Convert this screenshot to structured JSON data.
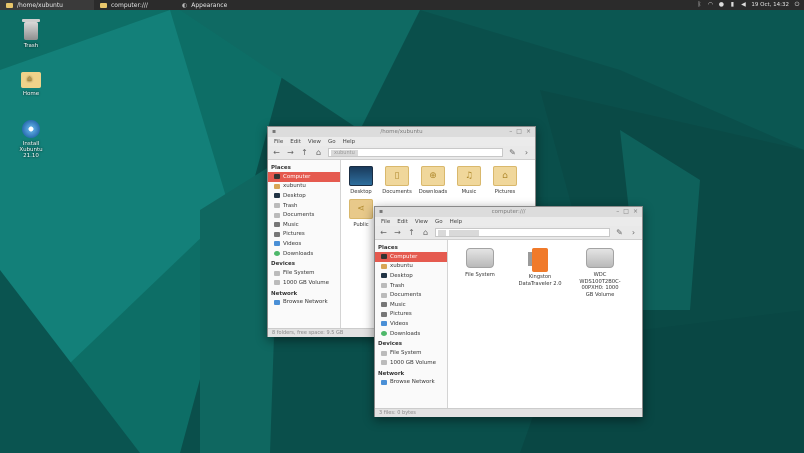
{
  "panel": {
    "tasks": [
      {
        "label": "/home/xubuntu",
        "icon": "folder-icon"
      },
      {
        "label": "computer:///",
        "icon": "folder-icon"
      },
      {
        "label": "Appearance",
        "icon": "appearance-icon"
      }
    ],
    "clock": "19 Oct, 14:32"
  },
  "desktop": {
    "icons": [
      {
        "label": "Trash",
        "icon": "trash-icon"
      },
      {
        "label": "Home",
        "icon": "home-folder-icon"
      },
      {
        "label": "Install Xubuntu 21.10",
        "icon": "install-disc-icon"
      }
    ]
  },
  "window_home": {
    "title": "/home/xubuntu",
    "menu": [
      "File",
      "Edit",
      "View",
      "Go",
      "Help"
    ],
    "crumb": "xubuntu",
    "sidebar": {
      "places_header": "Places",
      "places": [
        {
          "label": "Computer",
          "icon": "computer-icon",
          "selected": true
        },
        {
          "label": "xubuntu",
          "icon": "home-icon"
        },
        {
          "label": "Desktop",
          "icon": "desktop-icon"
        },
        {
          "label": "Trash",
          "icon": "trash-icon"
        },
        {
          "label": "Documents",
          "icon": "documents-icon"
        },
        {
          "label": "Music",
          "icon": "music-icon"
        },
        {
          "label": "Pictures",
          "icon": "pictures-icon"
        },
        {
          "label": "Videos",
          "icon": "videos-icon"
        },
        {
          "label": "Downloads",
          "icon": "downloads-icon"
        }
      ],
      "devices_header": "Devices",
      "devices": [
        {
          "label": "File System",
          "icon": "disk-icon"
        },
        {
          "label": "1000 GB Volume",
          "icon": "disk-icon"
        }
      ],
      "network_header": "Network",
      "network": [
        {
          "label": "Browse Network",
          "icon": "network-icon"
        }
      ]
    },
    "files": [
      {
        "label": "Desktop",
        "icon": "desktop-folder-icon"
      },
      {
        "label": "Documents",
        "icon": "documents-folder-icon"
      },
      {
        "label": "Downloads",
        "icon": "downloads-folder-icon"
      },
      {
        "label": "Music",
        "icon": "music-folder-icon"
      },
      {
        "label": "Pictures",
        "icon": "pictures-folder-icon"
      },
      {
        "label": "Public",
        "icon": "public-folder-icon"
      }
    ],
    "status": "8 folders, free space: 9.5 GB"
  },
  "window_computer": {
    "title": "computer:///",
    "menu": [
      "File",
      "Edit",
      "View",
      "Go",
      "Help"
    ],
    "sidebar": {
      "places_header": "Places",
      "places": [
        {
          "label": "Computer",
          "icon": "computer-icon",
          "selected": true
        },
        {
          "label": "xubuntu",
          "icon": "home-icon"
        },
        {
          "label": "Desktop",
          "icon": "desktop-icon"
        },
        {
          "label": "Trash",
          "icon": "trash-icon"
        },
        {
          "label": "Documents",
          "icon": "documents-icon"
        },
        {
          "label": "Music",
          "icon": "music-icon"
        },
        {
          "label": "Pictures",
          "icon": "pictures-icon"
        },
        {
          "label": "Videos",
          "icon": "videos-icon"
        },
        {
          "label": "Downloads",
          "icon": "downloads-icon"
        }
      ],
      "devices_header": "Devices",
      "devices": [
        {
          "label": "File System",
          "icon": "disk-icon"
        },
        {
          "label": "1000 GB Volume",
          "icon": "disk-icon"
        }
      ],
      "network_header": "Network",
      "network": [
        {
          "label": "Browse Network",
          "icon": "network-icon"
        }
      ]
    },
    "devices": [
      {
        "label": "File System",
        "icon": "harddisk-icon"
      },
      {
        "label": "Kingston DataTraveler 2.0",
        "icon": "usb-drive-icon"
      },
      {
        "label": "WDC WDS100T2B0C-00PXH0: 1000 GB Volume",
        "icon": "harddisk-icon"
      }
    ],
    "status": "3 files: 0 bytes"
  },
  "colors": {
    "selection": "#e55a4f",
    "panel": "#2b2b2b",
    "desktop": "#0c5a55"
  }
}
